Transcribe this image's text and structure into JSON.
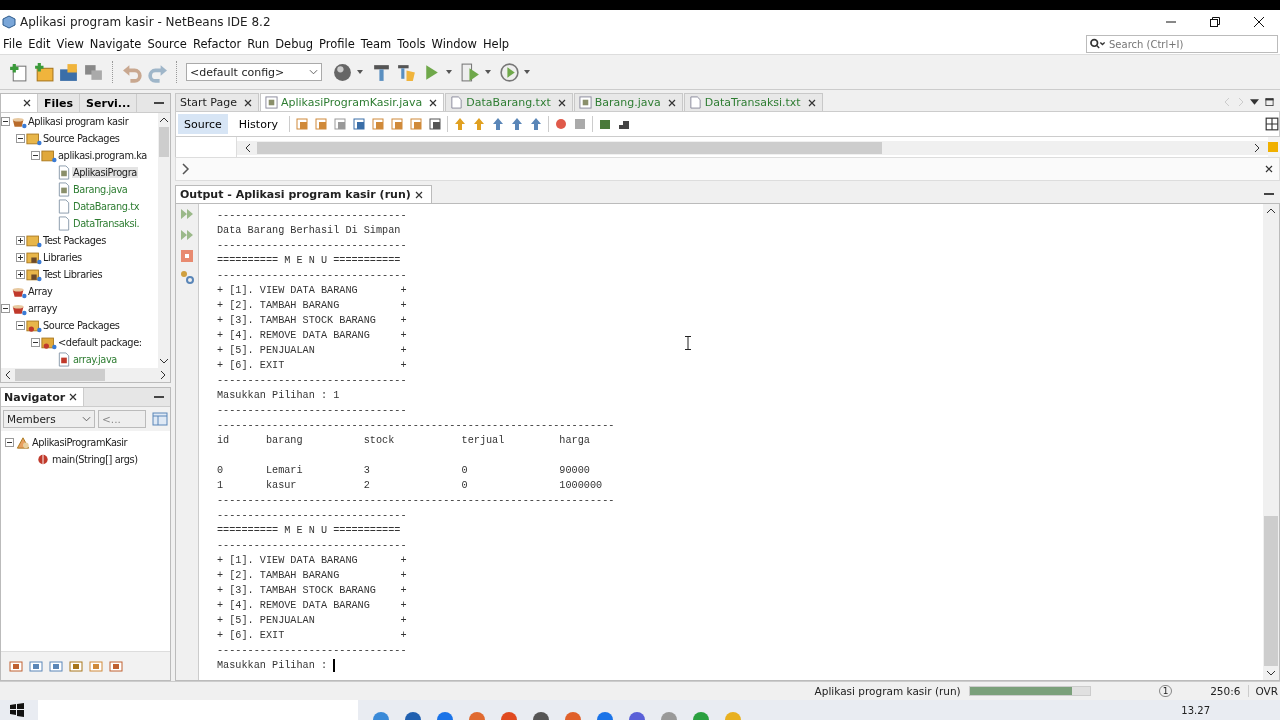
{
  "window": {
    "title": "Aplikasi program kasir - NetBeans IDE 8.2"
  },
  "menu": [
    "File",
    "Edit",
    "View",
    "Navigate",
    "Source",
    "Refactor",
    "Run",
    "Debug",
    "Profile",
    "Team",
    "Tools",
    "Window",
    "Help"
  ],
  "search": {
    "placeholder": "Search (Ctrl+I)"
  },
  "toolbar": {
    "config": "<default config>"
  },
  "projects_panel": {
    "tabs": [
      {
        "label": "Files",
        "selected": false
      },
      {
        "label": "Servi...",
        "selected": false
      }
    ],
    "tree": [
      {
        "label": "Aplikasi program kasir",
        "kind": "project",
        "expanded": true,
        "selected": false,
        "children": [
          {
            "label": "Source Packages",
            "kind": "source-folder",
            "expanded": true,
            "selected": false,
            "children": [
              {
                "label": "aplikasi.program.ka",
                "kind": "package",
                "expanded": true,
                "selected": false,
                "children": [
                  {
                    "label": "AplikasiProgra",
                    "kind": "java",
                    "selected": true,
                    "modified": false
                  },
                  {
                    "label": "Barang.java",
                    "kind": "java",
                    "selected": false,
                    "modified": true
                  },
                  {
                    "label": "DataBarang.tx",
                    "kind": "text",
                    "selected": false,
                    "modified": true
                  },
                  {
                    "label": "DataTransaksi.",
                    "kind": "text",
                    "selected": false,
                    "modified": true
                  }
                ]
              }
            ]
          },
          {
            "label": "Test Packages",
            "kind": "source-folder",
            "expanded": false,
            "selected": false
          },
          {
            "label": "Libraries",
            "kind": "library",
            "expanded": false,
            "selected": false
          },
          {
            "label": "Test Libraries",
            "kind": "library",
            "expanded": false,
            "selected": false
          }
        ]
      },
      {
        "label": "Array",
        "kind": "project-error",
        "selected": false
      },
      {
        "label": "arrayy",
        "kind": "project-error",
        "expanded": true,
        "selected": false,
        "children": [
          {
            "label": "Source Packages",
            "kind": "source-folder-error",
            "expanded": true,
            "selected": false,
            "children": [
              {
                "label": "<default package:",
                "kind": "package-error",
                "expanded": true,
                "selected": false,
                "children": [
                  {
                    "label": "array.java",
                    "kind": "java-error",
                    "selected": false,
                    "modified": true
                  }
                ]
              }
            ]
          }
        ]
      }
    ]
  },
  "navigator": {
    "title": "Navigator",
    "filter": "Members",
    "filter_2": "<...",
    "tree": [
      {
        "label": "AplikasiProgramKasir",
        "kind": "class",
        "expanded": true,
        "children": [
          {
            "label": "main(String[] args)",
            "kind": "method"
          }
        ]
      }
    ]
  },
  "editor": {
    "tabs": [
      {
        "label": "Start Page",
        "kind": "page",
        "selected": false,
        "modified": false
      },
      {
        "label": "AplikasiProgramKasir.java",
        "kind": "java",
        "selected": true,
        "modified": true
      },
      {
        "label": "DataBarang.txt",
        "kind": "text",
        "selected": false,
        "modified": true
      },
      {
        "label": "Barang.java",
        "kind": "java",
        "selected": false,
        "modified": true
      },
      {
        "label": "DataTransaksi.txt",
        "kind": "text",
        "selected": false,
        "modified": true
      }
    ],
    "views": [
      {
        "label": "Source",
        "selected": true
      },
      {
        "label": "History",
        "selected": false
      }
    ]
  },
  "output": {
    "title": "Output - Aplikasi program kasir (run)",
    "blocks": [
      [
        "-------------------------------",
        "Data Barang Berhasil Di Simpan",
        "-------------------------------",
        "========== M E N U ===========",
        "-------------------------------",
        "+ [1]. VIEW DATA BARANG       +",
        "+ [2]. TAMBAH BARANG          +",
        "+ [3]. TAMBAH STOCK BARANG    +",
        "+ [4]. REMOVE DATA BARANG     +",
        "+ [5]. PENJUALAN              +",
        "+ [6]. EXIT                   +",
        "-------------------------------",
        "Masukkan Pilihan : 1",
        "-------------------------------",
        "-----------------------------------------------------------------",
        "id      barang          stock           terjual         harga"
      ],
      [
        "0       Lemari          3               0               90000",
        "1       kasur           2               0               1000000",
        "-----------------------------------------------------------------",
        "-------------------------------",
        "========== M E N U ===========",
        "-------------------------------",
        "+ [1]. VIEW DATA BARANG       +",
        "+ [2]. TAMBAH BARANG          +",
        "+ [3]. TAMBAH STOCK BARANG    +",
        "+ [4]. REMOVE DATA BARANG     +",
        "+ [5]. PENJUALAN              +",
        "+ [6]. EXIT                   +",
        "-------------------------------"
      ]
    ],
    "input_line": {
      "text": "Masukkan Pilihan : ",
      "cursor": true
    }
  },
  "status_bar": {
    "task": "Aplikasi program kasir (run)",
    "progress": {
      "level": 0.85
    },
    "notifications": "1",
    "position": "250:6",
    "mode": "OVR"
  },
  "taskbar": {
    "time": "13.27"
  }
}
